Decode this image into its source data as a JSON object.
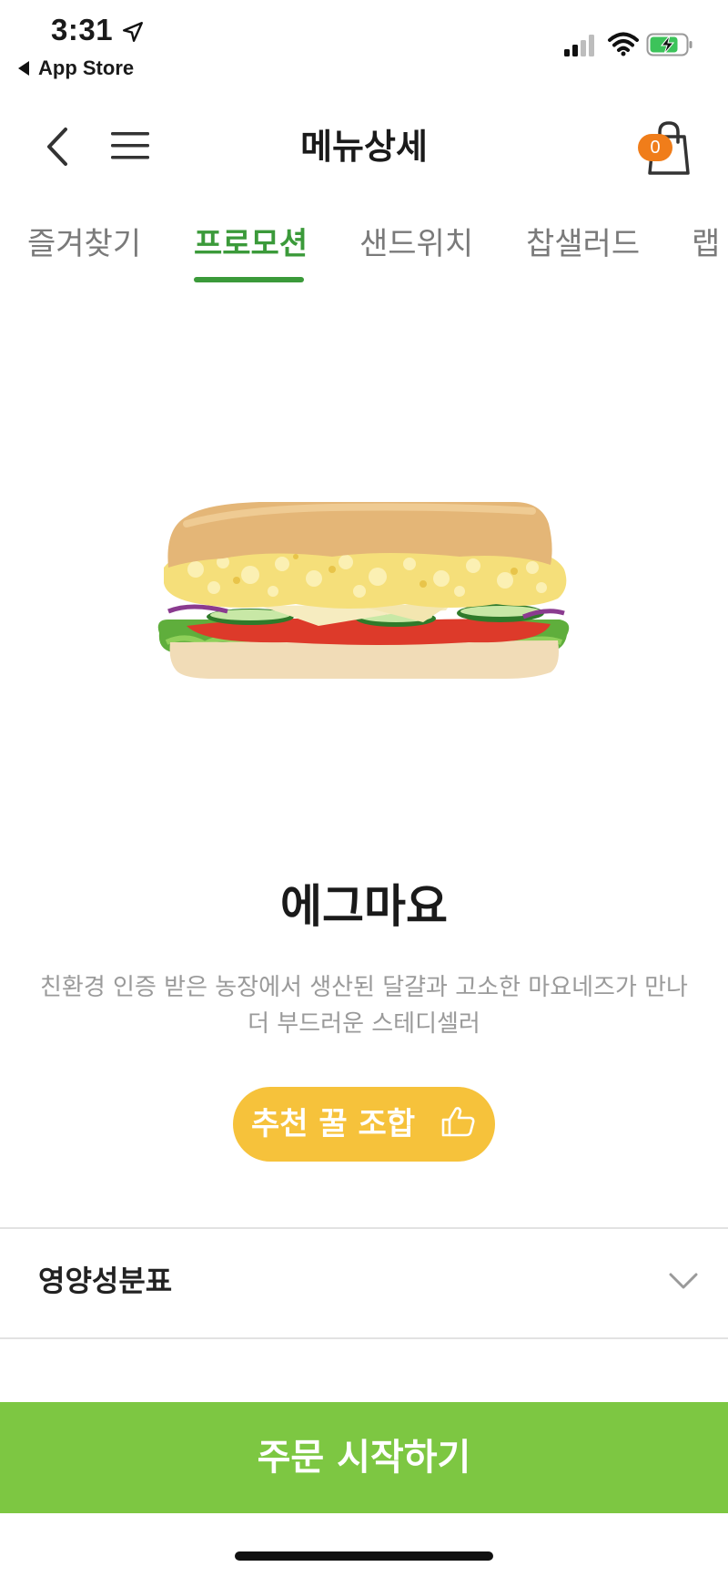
{
  "status_bar": {
    "time": "3:31",
    "back_app": "App Store",
    "icons": [
      "location-arrow-icon",
      "signal-icon",
      "wifi-icon",
      "battery-charging-icon"
    ]
  },
  "header": {
    "title": "메뉴상세",
    "cart_count": "0",
    "icons": [
      "chevron-left-icon",
      "hamburger-menu-icon",
      "shopping-bag-icon"
    ]
  },
  "tabs": [
    {
      "label": "즐겨찾기",
      "active": false
    },
    {
      "label": "프로모션",
      "active": true
    },
    {
      "label": "샌드위치",
      "active": false
    },
    {
      "label": "찹샐러드",
      "active": false
    },
    {
      "label": "랩",
      "active": false
    }
  ],
  "product": {
    "name": "에그마요",
    "description_line1": "친환경 인증 받은 농장에서 생산된 달걀과 고소한 마요네즈가 만나",
    "description_line2": "더 부드러운 스테디셀러",
    "combo_button": "추천 꿀 조합",
    "combo_icon": "thumbs-up-icon"
  },
  "nutrition": {
    "label": "영양성분표",
    "icon": "chevron-down-icon"
  },
  "order": {
    "label": "주문 시작하기"
  },
  "colors": {
    "accent_green": "#3b9a3a",
    "order_green": "#7dc742",
    "combo_yellow": "#f6c23b",
    "badge_orange": "#f07d1a"
  }
}
